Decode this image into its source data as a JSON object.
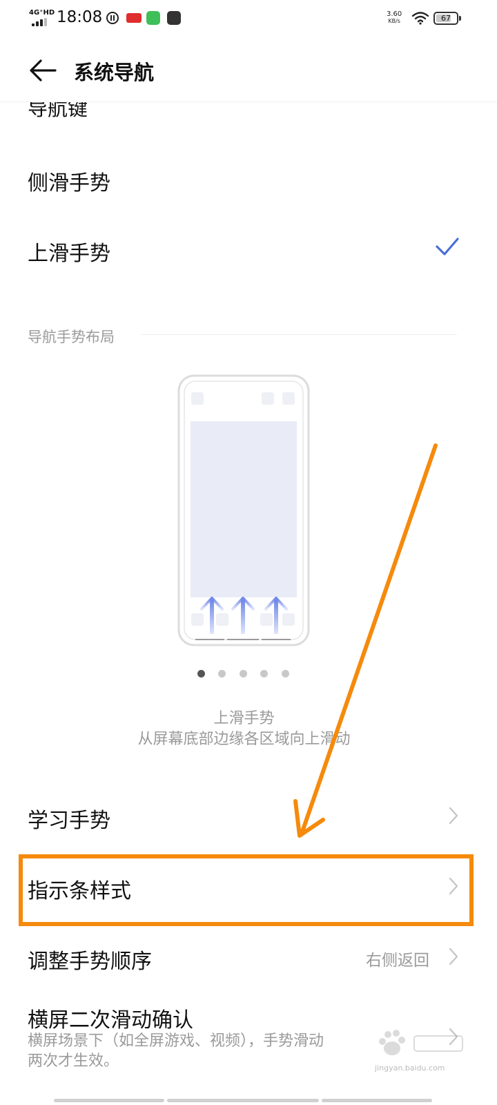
{
  "status_bar": {
    "network": "4G⁺HD",
    "time": "18:08",
    "speed_value": "3.60",
    "speed_unit": "KB/s",
    "battery": "67",
    "app_badges": [
      "toutiao-app-icon",
      "jingdong-app-icon",
      "shop-app-icon"
    ]
  },
  "header": {
    "title": "系统导航"
  },
  "nav_options": {
    "partial_item": "导航键",
    "items": [
      {
        "label": "侧滑手势",
        "selected": false
      },
      {
        "label": "上滑手势",
        "selected": true
      }
    ]
  },
  "layout_section": {
    "title": "导航手势布局",
    "illustration_title": "上滑手势",
    "illustration_desc": "从屏幕底部边缘各区域向上滑动",
    "page_count": 5,
    "active_page": 1
  },
  "settings": {
    "learn_gesture": "学习手势",
    "indicator_style": "指示条样式",
    "gesture_order": "调整手势顺序",
    "gesture_order_value": "右侧返回",
    "landscape_confirm": "横屏二次滑动确认",
    "landscape_desc_line1": "横屏场景下（如全屏游戏、视频），手势滑动",
    "landscape_desc_line2": "两次才生效。"
  },
  "watermark": {
    "text": "jingyan.baidu.com"
  },
  "colors": {
    "accent": "#4a6fd6",
    "highlight": "#f58a0c",
    "secondary_text": "#9a9a9a"
  }
}
